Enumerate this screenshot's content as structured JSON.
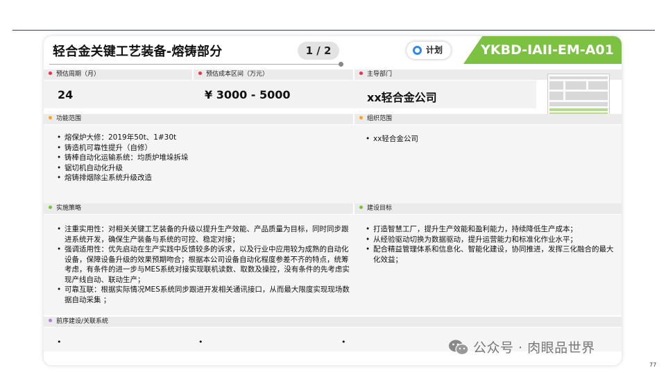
{
  "header": {
    "title": "轻合金关键工艺装备-熔铸部分",
    "page": "1 / 2",
    "status_button": "计划",
    "code": "YKBD-IAII-EM-A01"
  },
  "fields": {
    "period_label": "预估周期（月）",
    "period_value": "24",
    "cost_label": "预估成本区间（万元）",
    "cost_value": "¥ 3000 - 5000",
    "dept_label": "主导部门",
    "dept_value": "xx轻合金公司"
  },
  "sections": {
    "function_label": "功能范围",
    "function_items": [
      "熔保炉大修：2019年50t、1#30t",
      "铸造机可靠性提升（自修）",
      "铸棒自动化运输系统：均质炉堆垛拆垛",
      "锯切机自动化升级",
      "熔铸排烟除尘系统升级改造"
    ],
    "org_label": "组织范围",
    "org_items": [
      "xx轻合金公司"
    ],
    "strategy_label": "实施策略",
    "strategy_items": [
      "注重实用性：对相关关键工艺装备的升级以提升生产效能、产品质量为目标，同时同步跟进系统开发，确保生产装备与系统的可控、稳定对接；",
      "强调适用性：优先启动在生产实践中反馈较多的诉求，以及行业中应用较为成熟的自动化设备，保障设备升级的效果预期吻合；根据本公司设备自动化程度参差不齐的特点，统筹考虑，有条件的进一步与MES系统对接实现联机读数、取数及操控，没有条件的先考虑实现产线自动、联动生产；",
      "可靠互联：根据实际情况MES系统同步跟进开发相关通讯接口，从而最大限度实现现场数据自动采集 ；"
    ],
    "goal_label": "建设目标",
    "goal_items": [
      "打造智慧工厂，提升生产效能和盈利能力，持续降低生产成本；",
      "从经验驱动切换为数据驱动，提升运营能力和标准化作业水平；",
      "配合精益管理体系和信息化、智能化建设，协同推进，发挥三化融合的最大化效益；"
    ],
    "related_label": "前序建设/关联系统"
  },
  "colors": {
    "accent_green": "#7dc142",
    "dot_red": "#e8344e",
    "dot_orange": "#f5a623",
    "dot_green": "#7dc142",
    "dot_purple": "#b07fd8",
    "icon_blue": "#2e8ae6"
  },
  "footer": {
    "watermark": "公众号 · 肉眼品世界",
    "page_number": "77"
  }
}
